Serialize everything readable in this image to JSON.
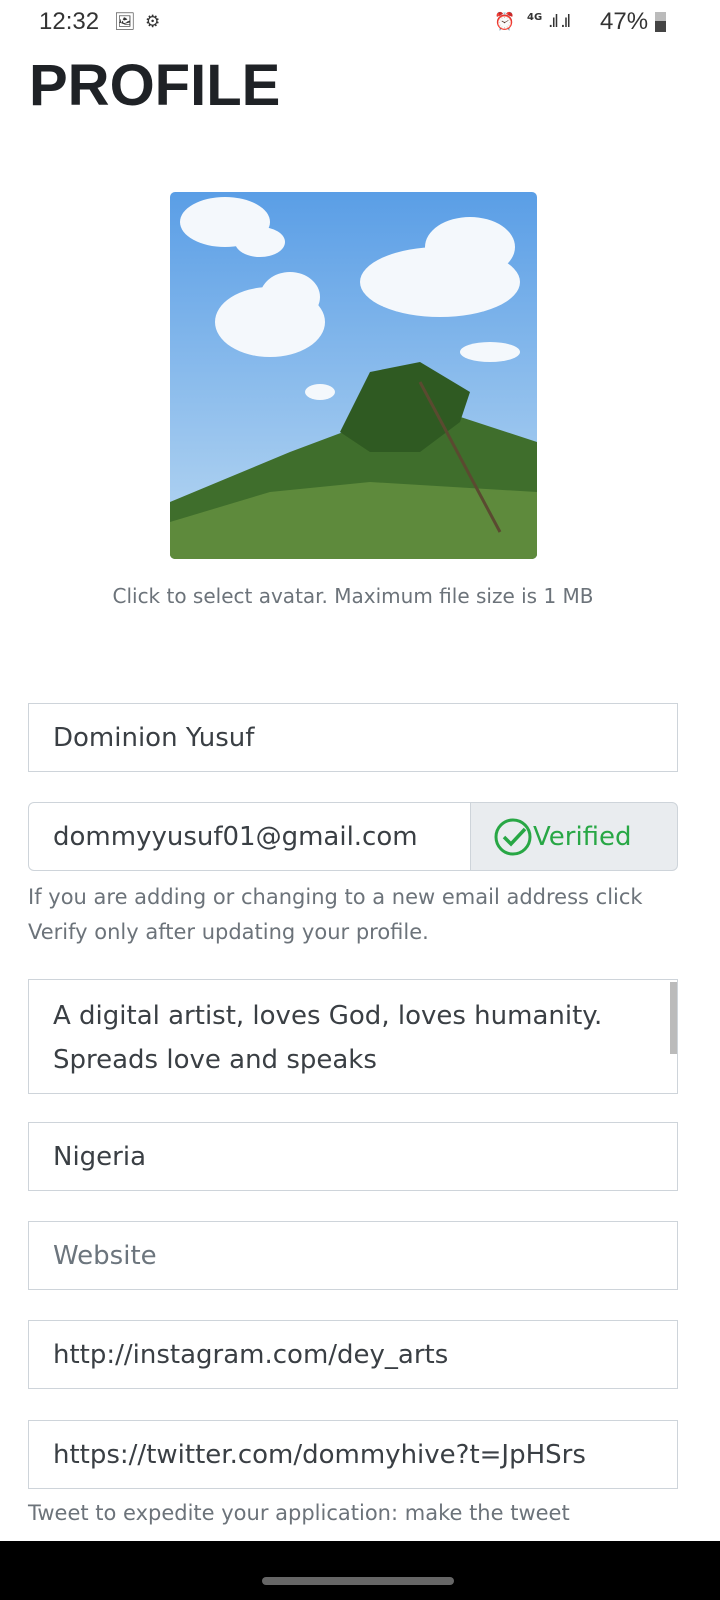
{
  "status_bar": {
    "time": "12:32",
    "battery": "47%",
    "network": "4G",
    "icons": [
      "image-icon",
      "vpn-icon",
      "alarm-icon",
      "signal-icon",
      "battery-icon"
    ]
  },
  "page": {
    "title": "PROFILE"
  },
  "avatar": {
    "hint": "Click to select avatar. Maximum file size is 1 MB"
  },
  "form": {
    "name": "Dominion Yusuf",
    "email": "dommyyusuf01@gmail.com",
    "verified_label": "Verified",
    "email_help": "If you are adding or changing to a new email address click Verify only after updating your profile.",
    "bio": "A digital artist, loves God, loves humanity. Spreads love and speaks",
    "country": "Nigeria",
    "website_placeholder": "Website",
    "instagram": "http://instagram.com/dey_arts",
    "twitter": "https://twitter.com/dommyhive?t=JpHSrs",
    "tweet_help": "Tweet to expedite your application: make the tweet"
  },
  "colors": {
    "verified": "#28a745",
    "border": "#ced4da"
  }
}
